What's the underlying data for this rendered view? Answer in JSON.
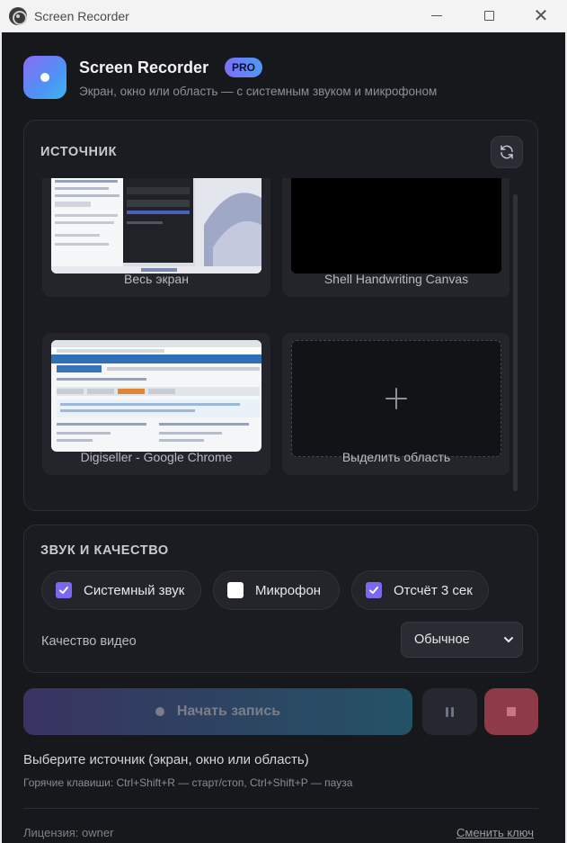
{
  "window": {
    "title": "Screen Recorder",
    "controls": {
      "minimize": "minimize-icon",
      "maximize": "maximize-icon",
      "close": "close-icon"
    }
  },
  "header": {
    "title": "Screen Recorder",
    "badge": "PRO",
    "subtitle": "Экран, окно или область — с системным звуком и микрофоном"
  },
  "source": {
    "heading": "ИСТОЧНИК",
    "refresh_icon": "refresh-icon",
    "items": [
      {
        "label": "Весь экран",
        "thumbnail": "desktop screen preview"
      },
      {
        "label": "Shell Handwriting Canvas",
        "thumbnail": "black window preview"
      },
      {
        "label": "Digiseller - Google Chrome",
        "thumbnail": "browser window preview"
      },
      {
        "label": "Выделить область",
        "icon": "plus-icon"
      }
    ]
  },
  "sound": {
    "heading": "ЗВУК И КАЧЕСТВО",
    "options": [
      {
        "label": "Системный звук",
        "checked": true
      },
      {
        "label": "Микрофон",
        "checked": false
      },
      {
        "label": "Отсчёт 3 сек",
        "checked": true
      }
    ],
    "quality_label": "Качество видео",
    "quality_value": "Обычное"
  },
  "controls": {
    "record_label": "Начать запись",
    "pause_icon": "pause-icon",
    "stop_icon": "stop-icon"
  },
  "status": {
    "message": "Выберите источник (экран, окно или область)",
    "hotkeys": "Горячие клавиши: Ctrl+Shift+R — старт/стоп, Ctrl+Shift+P — пауза"
  },
  "footer": {
    "license": "Лицензия: owner",
    "change_key": "Сменить ключ"
  },
  "colors": {
    "background": "#17181c",
    "accent": "#7a69ee",
    "stop": "#8e3a47"
  }
}
